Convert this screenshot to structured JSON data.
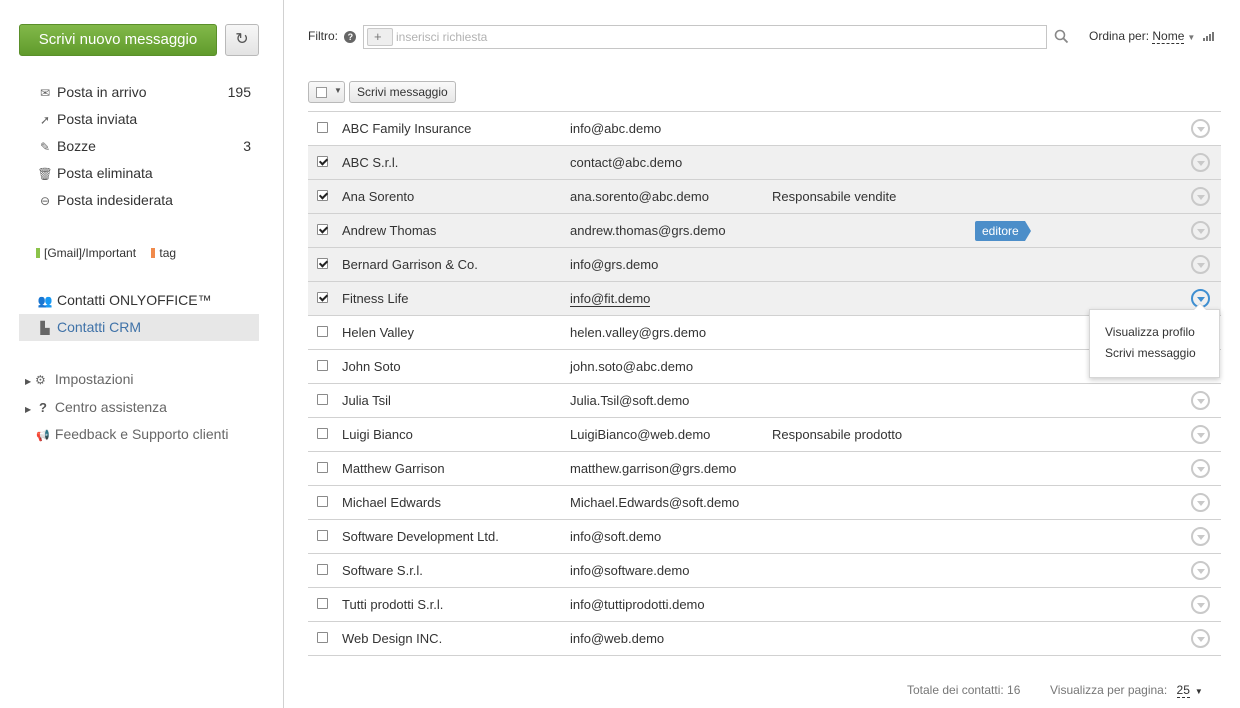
{
  "sidebar": {
    "compose_label": "Scrivi nuovo messaggio",
    "folders": [
      {
        "label": "Posta in arrivo",
        "count": "195",
        "icon": "inbox-icon"
      },
      {
        "label": "Posta inviata",
        "count": "",
        "icon": "sent-icon"
      },
      {
        "label": "Bozze",
        "count": "3",
        "icon": "drafts-icon"
      },
      {
        "label": "Posta eliminata",
        "count": "",
        "icon": "trash-icon"
      },
      {
        "label": "Posta indesiderata",
        "count": "",
        "icon": "spam-icon"
      }
    ],
    "tags": [
      {
        "label": "[Gmail]/Important",
        "color": "#8bc34a"
      },
      {
        "label": "tag",
        "color": "#f08a4b"
      }
    ],
    "contacts": [
      {
        "label": "Contatti ONLYOFFICE™",
        "icon": "people-icon"
      },
      {
        "label": "Contatti CRM",
        "icon": "crm-icon",
        "active": true
      }
    ],
    "nav": [
      {
        "label": "Impostazioni",
        "icon": "gear-icon"
      },
      {
        "label": "Centro assistenza",
        "icon": "question-icon"
      },
      {
        "label": "Feedback e Supporto clienti",
        "icon": "megaphone-icon"
      }
    ]
  },
  "filter": {
    "label": "Filtro:",
    "help": "?",
    "add": "+",
    "placeholder": "inserisci richiesta",
    "order_label": "Ordina per:",
    "order_value": "Nome"
  },
  "toolbar": {
    "write_label": "Scrivi messaggio"
  },
  "contacts": [
    {
      "name": "ABC Family Insurance",
      "email": "info@abc.demo",
      "title": "",
      "tag": "",
      "checked": false
    },
    {
      "name": "ABC S.r.l.",
      "email": "contact@abc.demo",
      "title": "",
      "tag": "",
      "checked": true
    },
    {
      "name": "Ana Sorento",
      "email": "ana.sorento@abc.demo",
      "title": "Responsabile vendite",
      "tag": "",
      "checked": true
    },
    {
      "name": "Andrew Thomas",
      "email": "andrew.thomas@grs.demo",
      "title": "",
      "tag": "editore",
      "checked": true
    },
    {
      "name": "Bernard Garrison & Co.",
      "email": "info@grs.demo",
      "title": "",
      "tag": "",
      "checked": true
    },
    {
      "name": "Fitness Life",
      "email": "info@fit.demo",
      "title": "",
      "tag": "",
      "checked": true
    },
    {
      "name": "Helen Valley",
      "email": "helen.valley@grs.demo",
      "title": "",
      "tag": "",
      "checked": false
    },
    {
      "name": "John Soto",
      "email": "john.soto@abc.demo",
      "title": "",
      "tag": "",
      "checked": false
    },
    {
      "name": "Julia Tsil",
      "email": "Julia.Tsil@soft.demo",
      "title": "",
      "tag": "",
      "checked": false
    },
    {
      "name": "Luigi Bianco",
      "email": "LuigiBianco@web.demo",
      "title": "Responsabile prodotto",
      "tag": "",
      "checked": false
    },
    {
      "name": "Matthew Garrison",
      "email": "matthew.garrison@grs.demo",
      "title": "",
      "tag": "",
      "checked": false
    },
    {
      "name": "Michael Edwards",
      "email": "Michael.Edwards@soft.demo",
      "title": "",
      "tag": "",
      "checked": false
    },
    {
      "name": "Software Development Ltd.",
      "email": "info@soft.demo",
      "title": "",
      "tag": "",
      "checked": false
    },
    {
      "name": "Software S.r.l.",
      "email": "info@software.demo",
      "title": "",
      "tag": "",
      "checked": false
    },
    {
      "name": "Tutti prodotti S.r.l.",
      "email": "info@tuttiprodotti.demo",
      "title": "",
      "tag": "",
      "checked": false
    },
    {
      "name": "Web Design INC.",
      "email": "info@web.demo",
      "title": "",
      "tag": "",
      "checked": false
    }
  ],
  "context_menu": {
    "items": [
      "Visualizza profilo",
      "Scrivi messaggio"
    ]
  },
  "footer": {
    "total_label": "Totale dei contatti: 16",
    "per_page_label": "Visualizza per pagina:",
    "per_page_value": "25"
  },
  "colors": {
    "compose_green": "#6ea637",
    "tag_blue": "#4c8ec9",
    "active_blue": "#3f8fd1"
  }
}
